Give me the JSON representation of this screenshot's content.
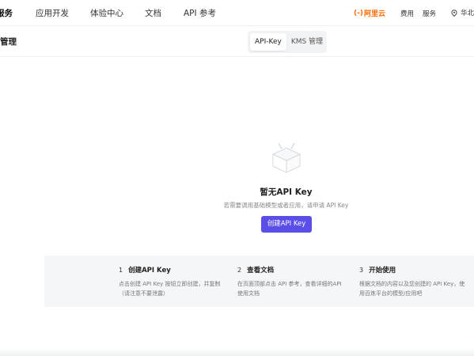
{
  "nav": {
    "items": [
      {
        "label": "服务",
        "active": true
      },
      {
        "label": "应用开发"
      },
      {
        "label": "体验中心"
      },
      {
        "label": "文档"
      },
      {
        "label": "API 参考"
      }
    ],
    "brand_glyph": "(-)",
    "brand_name": "阿里云",
    "links": [
      "费用",
      "服务"
    ],
    "region": "华北"
  },
  "page": {
    "title": "管理",
    "tabs": [
      {
        "label": "API-Key",
        "selected": true
      },
      {
        "label": "KMS 管理"
      }
    ]
  },
  "empty": {
    "title": "暂无API Key",
    "description": "若需要调用基础模型或者应用，请申请 API Key",
    "button": "创建API Key"
  },
  "steps": [
    {
      "num": "1",
      "title": "创建API Key",
      "text": "点击创建 API Key 按钮立即创建，并复制（请注意不要泄露）"
    },
    {
      "num": "2",
      "title": "查看文档",
      "text": "在页面顶部点击 API 参考，查看详细的API使用文档"
    },
    {
      "num": "3",
      "title": "开始使用",
      "text": "根据文档的内容以及您创建的 API Key，使用百炼平台的模型/应用吧"
    }
  ],
  "colors": {
    "accent": "#5b4ee8",
    "brand": "#ff6a00",
    "panel": "#f5f6f8"
  }
}
